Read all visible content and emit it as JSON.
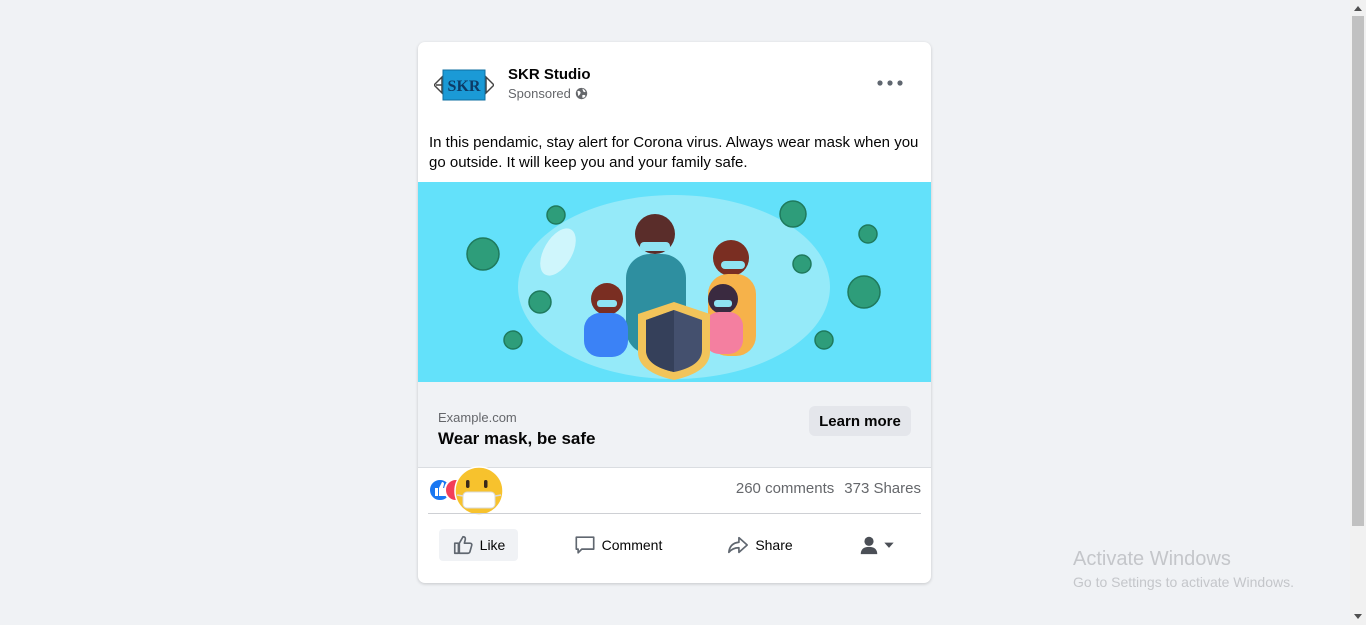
{
  "post": {
    "page_name": "SKR Studio",
    "logo_text": "SKR",
    "sponsored_label": "Sponsored",
    "text": "In this pendamic, stay alert for Corona virus. Always wear mask when you go outside. It will keep you and your family safe.",
    "link": {
      "domain": "Example.com",
      "headline": "Wear mask, be safe",
      "cta_label": "Learn more"
    },
    "stats": {
      "comments": "260 comments",
      "shares": "373 Shares"
    },
    "actions": {
      "like": "Like",
      "comment": "Comment",
      "share": "Share"
    }
  },
  "reactions": [
    "like-icon",
    "love-icon",
    "mask-face-emoji"
  ],
  "windows_watermark": {
    "title": "Activate Windows",
    "subtitle": "Go to Settings to activate Windows."
  },
  "colors": {
    "page_bg": "#f0f2f5",
    "image_bg": "#63e1fa",
    "logo_blue": "#1b9ad6",
    "like_blue": "#1877f2",
    "secondary_text": "#65676b"
  }
}
